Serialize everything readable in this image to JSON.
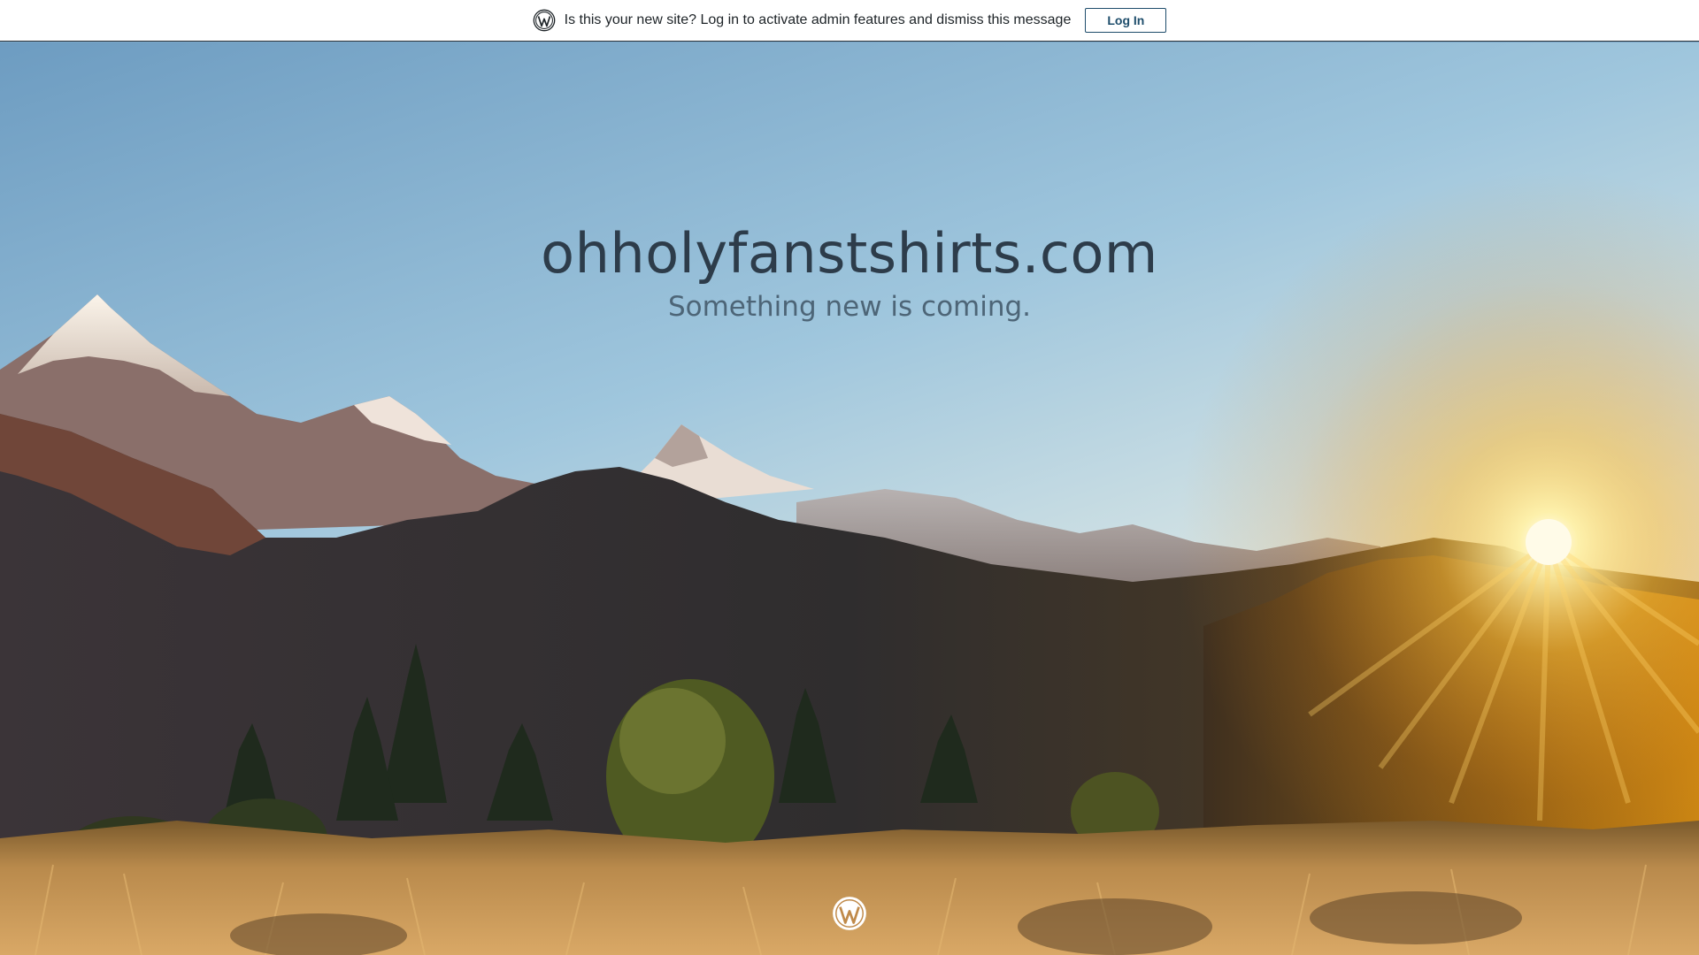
{
  "admin_bar": {
    "message": "Is this your new site? Log in to activate admin features and dismiss this message",
    "login_label": "Log In",
    "logo_icon": "wordpress-logo-icon"
  },
  "hero": {
    "site_title": "ohholyfanstshirts.com",
    "tagline": "Something new is coming.",
    "background": "mountain-sunrise-landscape"
  },
  "footer": {
    "logo_icon": "wordpress-logo-icon"
  },
  "colors": {
    "title": "#2d3c4a",
    "tagline": "#4d6577",
    "button_border": "#1e4d6b",
    "admin_bar_bg": "#ffffff"
  }
}
